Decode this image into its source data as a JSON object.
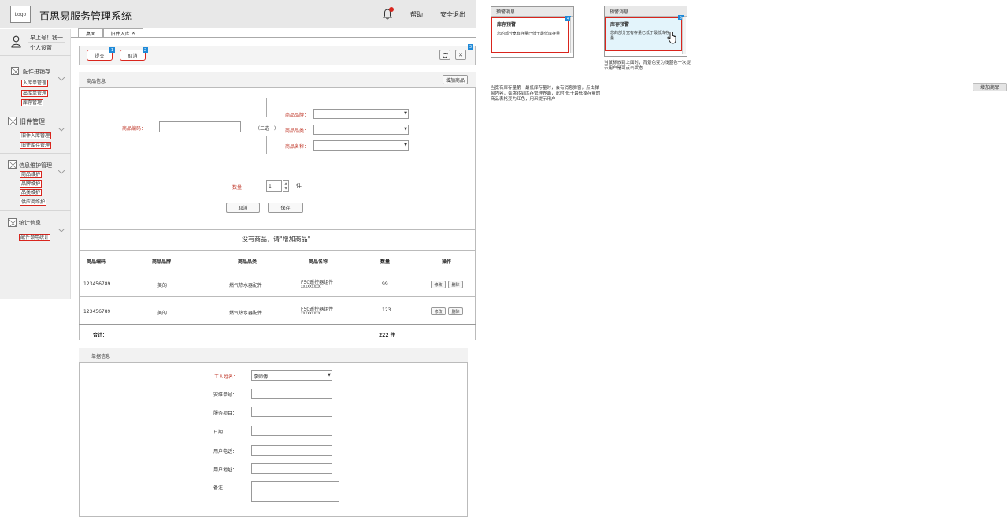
{
  "header": {
    "logo": "Logo",
    "title": "百思易服务管理系统",
    "help": "帮助",
    "logout": "安全退出",
    "badge": "3"
  },
  "sidebar": {
    "greeting": "早上号！钱一",
    "personal": "个人设置",
    "groups": [
      {
        "label": "配件进销存",
        "items": [
          "入库单管理",
          "出库单管理",
          "库存管理"
        ]
      },
      {
        "label": "旧件管理",
        "items": [
          "旧件入库管理",
          "旧件库存管理"
        ]
      },
      {
        "label": "信息维护管理",
        "items": [
          "商品维护",
          "品牌维护",
          "品类维护",
          "供应商维护"
        ]
      },
      {
        "label": "统计信息",
        "items": [
          "配件领用统计"
        ]
      }
    ]
  },
  "tabs": [
    "桌面",
    "旧件入库"
  ],
  "toolbar": {
    "submit": "提交",
    "cancel": "取消",
    "marker1": "1",
    "marker2": "2",
    "marker3": "3"
  },
  "product": {
    "title": "商品信息",
    "add_button": "增加商品",
    "code_label": "商品编码：",
    "either": "（二选一）",
    "brand_label": "商品品牌：",
    "category_label": "商品品类：",
    "name_label": "商品名称：",
    "qty_label": "数量：",
    "qty_value": "1",
    "qty_unit": "件",
    "cancel": "取消",
    "save": "保存",
    "empty_msg": "没有商品，请\"增加商品\""
  },
  "table": {
    "columns": [
      "商品编码",
      "商品品牌",
      "商品品类",
      "商品名称",
      "数量",
      "操作"
    ],
    "rows": [
      {
        "code": "123456789",
        "brand": "美的",
        "category": "燃气热水器配件",
        "name": "F50遥控器组件",
        "sub": "XXXXXXXXX",
        "qty": "99",
        "edit": "修改",
        "del": "删除"
      },
      {
        "code": "123456789",
        "brand": "美的",
        "category": "燃气热水器配件",
        "name": "F50遥控器组件",
        "sub": "XXXXXXXXX",
        "qty": "123",
        "edit": "修改",
        "del": "删除"
      }
    ],
    "total_label": "合计：",
    "total_value": "222 件"
  },
  "form": {
    "title": "单据信息",
    "worker_label": "工人姓名：",
    "worker_value": "李师傅",
    "order_label": "安维单号：",
    "service_label": "服务项目：",
    "date_label": "日期：",
    "phone_label": "用户电话：",
    "address_label": "用户地址：",
    "note_label": "备注："
  },
  "annotations": {
    "card_head": "预警消息",
    "card_title": "库存预警",
    "card_body": "您的部分宽有存量已低于最低库存量",
    "marker4": "4",
    "marker5": "5",
    "hover_note": "当鼠标放到上面时，背景色变为浅蓝色一次提示用户是可点击状态",
    "desc_note": "当宽有库存量第一最低库存量时，会有消息弹窗，点击弹窗内容，会跳转到库存管理界面，此时 低于最低掉存量的商品表格变为红色，用来提示用户",
    "add_button": "增加商品"
  },
  "colors": {
    "accent_red": "#d9251d",
    "marker_blue": "#1f8ad8",
    "hover_blue": "#e3f4fb"
  }
}
